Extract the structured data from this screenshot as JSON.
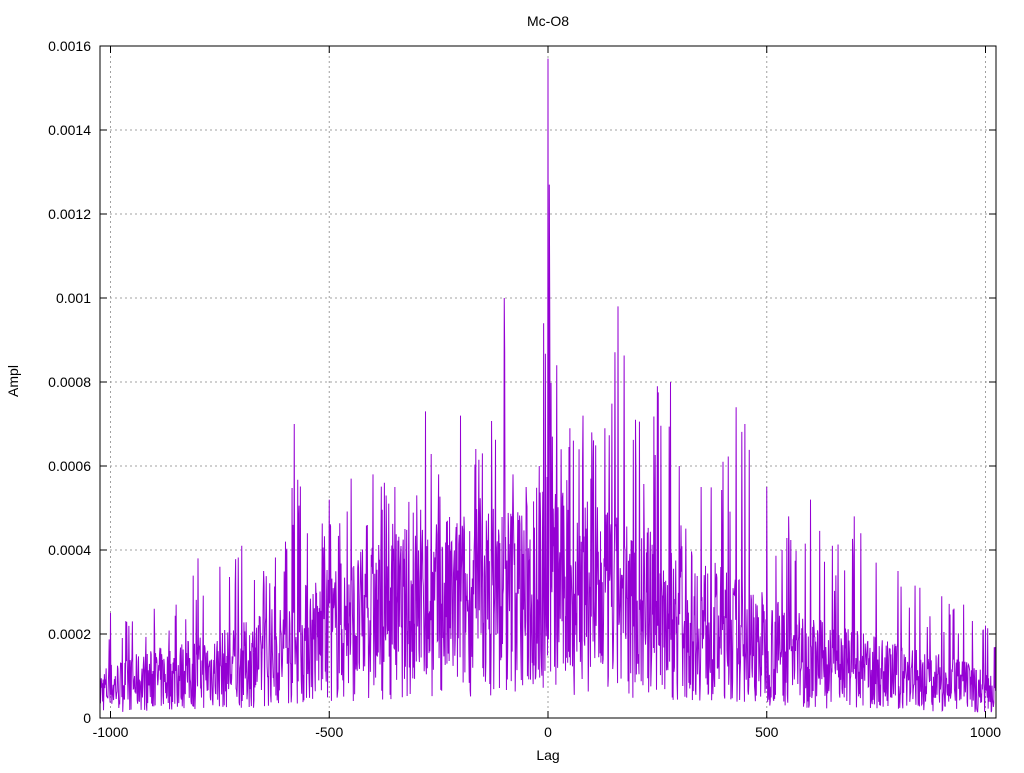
{
  "chart_data": {
    "type": "line",
    "title": "Mc-O8",
    "xlabel": "Lag",
    "ylabel": "Ampl",
    "xlim": [
      -1024,
      1024
    ],
    "ylim": [
      0,
      0.0016
    ],
    "xticks": [
      -1000,
      -500,
      0,
      500,
      1000
    ],
    "xtick_labels": [
      "-1000",
      "-500",
      "0",
      "500",
      "1000"
    ],
    "yticks": [
      0,
      0.0002,
      0.0004,
      0.0006,
      0.0008,
      0.001,
      0.0012,
      0.0014,
      0.0016
    ],
    "ytick_labels": [
      "0",
      "0.0002",
      "0.0004",
      "0.0006",
      "0.0008",
      "0.001",
      "0.0012",
      "0.0014",
      "0.0016"
    ],
    "grid": true,
    "series_color": "#9400d3",
    "envelope_note_free": true,
    "series": [
      {
        "x": [
          -1024,
          -1000,
          -950,
          -900,
          -850,
          -800,
          -750,
          -700,
          -650,
          -600,
          -580,
          -550,
          -500,
          -450,
          -400,
          -350,
          -300,
          -280,
          -250,
          -200,
          -150,
          -100,
          -80,
          -50,
          -20,
          -10,
          0,
          10,
          20,
          30,
          50,
          80,
          100,
          130,
          160,
          200,
          250,
          280,
          300,
          350,
          400,
          430,
          450,
          500,
          550,
          600,
          650,
          700,
          750,
          800,
          850,
          900,
          950,
          1000,
          1024
        ],
        "y_peak": [
          0.00013,
          0.00025,
          0.00023,
          0.00026,
          0.00027,
          0.00038,
          0.00036,
          0.00041,
          0.00035,
          0.00042,
          0.0007,
          0.00044,
          0.00052,
          0.00057,
          0.00058,
          0.00055,
          0.00053,
          0.00073,
          0.00058,
          0.00072,
          0.00063,
          0.001,
          0.00058,
          0.00055,
          0.0006,
          0.00094,
          0.00157,
          0.00067,
          0.00084,
          0.00064,
          0.00069,
          0.00072,
          0.00068,
          0.00069,
          0.00098,
          0.00071,
          0.00079,
          0.0008,
          0.0006,
          0.00055,
          0.00061,
          0.00074,
          0.0007,
          0.00055,
          0.00048,
          0.00052,
          0.00041,
          0.00048,
          0.00037,
          0.00035,
          0.00031,
          0.00029,
          0.00027,
          0.00022,
          0.00019
        ],
        "y_typical": [
          8e-05,
          9e-05,
          0.0001,
          0.00011,
          0.00012,
          0.00013,
          0.00014,
          0.00015,
          0.00017,
          0.00019,
          0.0002,
          0.00022,
          0.00024,
          0.00026,
          0.00028,
          0.0003,
          0.00031,
          0.00031,
          0.00032,
          0.00033,
          0.00034,
          0.00035,
          0.00035,
          0.00036,
          0.00037,
          0.00038,
          0.00045,
          0.00038,
          0.00037,
          0.00036,
          0.00036,
          0.00035,
          0.00034,
          0.00033,
          0.00032,
          0.00031,
          0.0003,
          0.00029,
          0.00028,
          0.00026,
          0.00024,
          0.00023,
          0.00022,
          0.0002,
          0.00018,
          0.00016,
          0.00015,
          0.00014,
          0.00013,
          0.00012,
          0.00011,
          0.0001,
          9e-05,
          8e-05,
          8e-05
        ]
      }
    ]
  }
}
